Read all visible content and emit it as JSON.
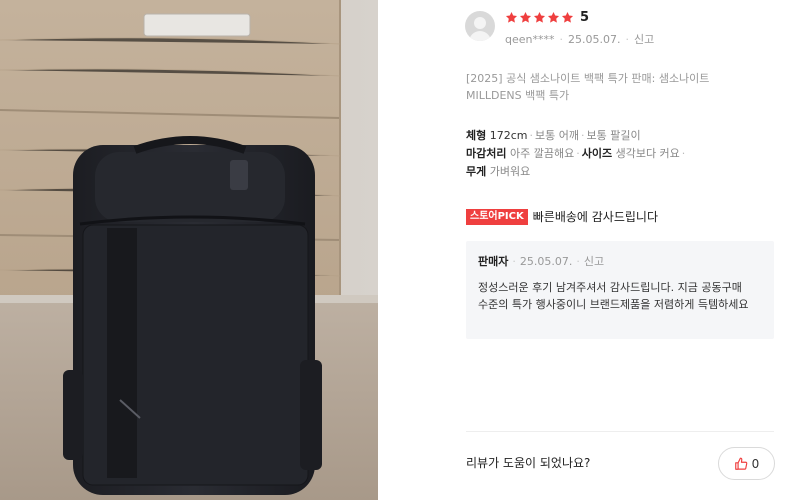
{
  "review": {
    "rating": "5",
    "star_color": "#ef3f3f",
    "author": "qeen****",
    "date": "25.05.07.",
    "report_label": "신고",
    "option_line1": "[2025] 공식 샘소나이트 백팩 특가 판매: 샘소나이트",
    "option_line2": "MILLDENS 백팩 특가",
    "attributes": {
      "body_label": "체형",
      "body_value": "172cm",
      "shoulder": "보통 어깨",
      "arm": "보통 팔길이",
      "finish_label": "마감처리",
      "finish_value": "아주 깔끔해요",
      "size_label": "사이즈",
      "size_value": "생각보다 커요",
      "weight_label": "무게",
      "weight_value": "가벼워요"
    },
    "pick_badge": "스토어PICK",
    "pick_text": "빠른배송에 감사드립니다"
  },
  "seller_reply": {
    "name": "판매자",
    "date": "25.05.07.",
    "report_label": "신고",
    "body": "정성스러운 후기 남겨주셔서 감사드립니다. 지금 공동구매 수준의 특가 행사중이니 브랜드제품을 저렴하게 득템하세요"
  },
  "helpful": {
    "question": "리뷰가 도움이 되었나요?",
    "count": "0"
  },
  "photo": {
    "icon": "review-photo-backpack"
  }
}
